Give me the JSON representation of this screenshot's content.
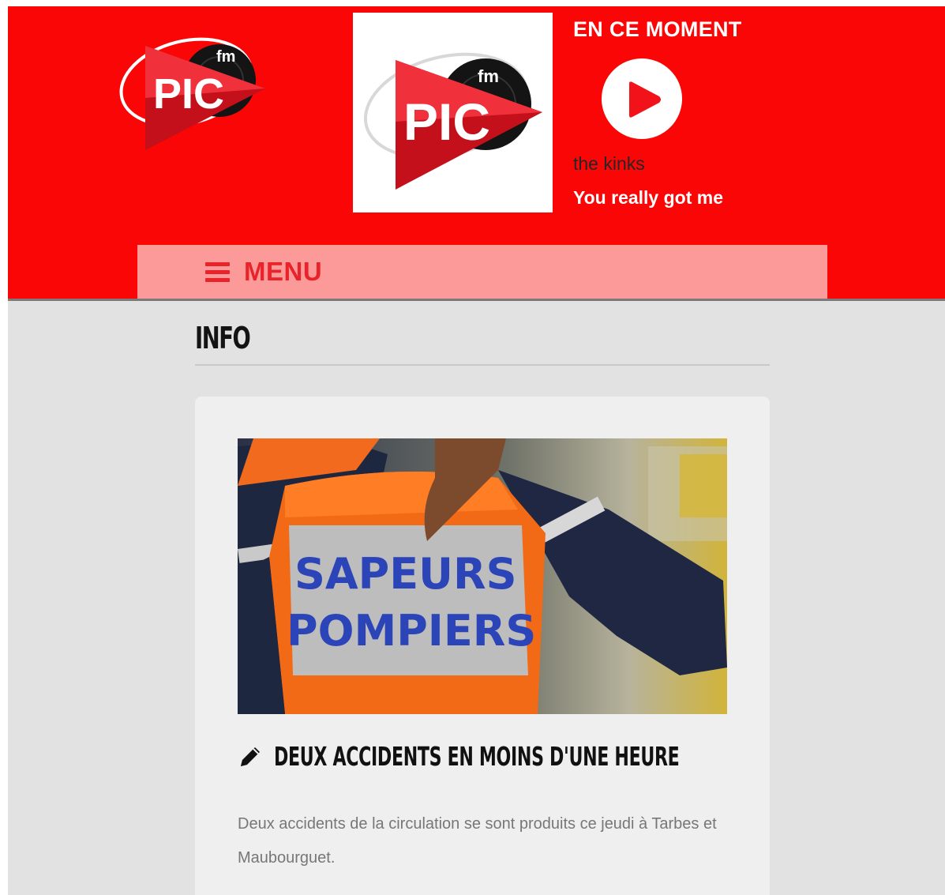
{
  "header": {
    "brand": "PIC fm",
    "now_playing_label": "EN CE MOMENT",
    "artist": "the kinks",
    "track_title": "You really got me",
    "play_icon": "play-icon",
    "colors": {
      "header_bg": "#fa0606",
      "menu_bg": "#fc9a9a",
      "menu_text": "#e8242a"
    }
  },
  "nav": {
    "menu_label": "MENU",
    "menu_icon": "hamburger-icon"
  },
  "section": {
    "title": "INFO"
  },
  "article": {
    "image_caption": "SAPEURS POMPIERS",
    "image_line1": "SAPEURS",
    "image_line2": "POMPIERS",
    "title": "DEUX ACCIDENTS EN MOINS D'UNE HEURE",
    "title_icon": "pencil-icon",
    "excerpt": "Deux accidents de la circulation se sont produits ce jeudi à Tarbes et Maubourguet."
  }
}
